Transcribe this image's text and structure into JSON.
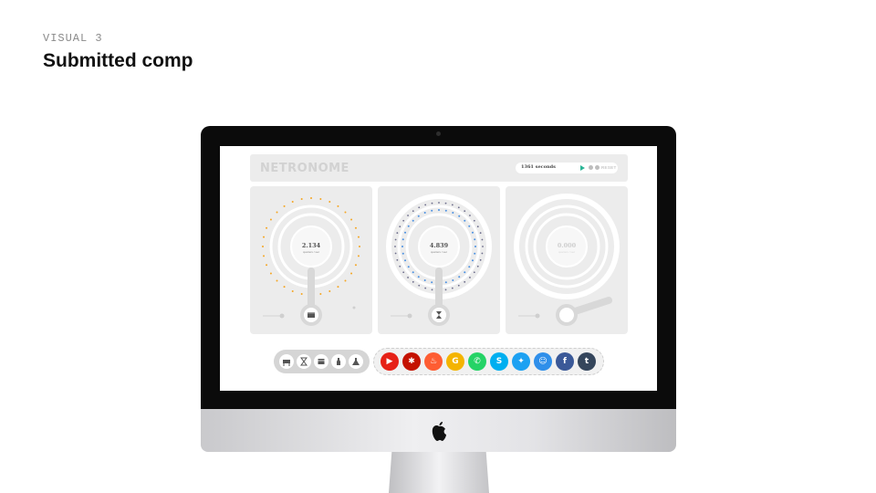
{
  "slide": {
    "label": "VISUAL 3",
    "title": "Submitted comp"
  },
  "app": {
    "logo": "NETRONOME",
    "timer": {
      "text": "1361 seconds",
      "reset_label": "RESET",
      "accent": "#2bb596"
    },
    "panels": [
      {
        "value": "2.134",
        "unit": "quarters / sec",
        "dot_color": "#f5a623",
        "active": true,
        "handle_icon": "box-icon"
      },
      {
        "value": "4.839",
        "unit": "quarters / sec",
        "dot_color": "#4a90e2",
        "active": true,
        "handle_icon": "hourglass-icon"
      },
      {
        "value": "0.000",
        "unit": "quarters / sec",
        "dot_color": "#e0e0e0",
        "active": false,
        "handle_icon": "none"
      }
    ],
    "sounds": [
      {
        "name": "piano-icon"
      },
      {
        "name": "hourglass-icon"
      },
      {
        "name": "box-icon"
      },
      {
        "name": "bottle-icon"
      },
      {
        "name": "flask-icon"
      }
    ],
    "share": [
      {
        "network": "youtube",
        "glyph": "▶",
        "color": "#e62117"
      },
      {
        "network": "yelp",
        "glyph": "✱",
        "color": "#c41200"
      },
      {
        "network": "tinder",
        "glyph": "♨",
        "color": "#fe5d32"
      },
      {
        "network": "google",
        "glyph": "G",
        "color": "#f4b400"
      },
      {
        "network": "whatsapp",
        "glyph": "✆",
        "color": "#25d366"
      },
      {
        "network": "skype",
        "glyph": "S",
        "color": "#00aff0"
      },
      {
        "network": "twitter",
        "glyph": "✦",
        "color": "#1da1f2"
      },
      {
        "network": "reddit",
        "glyph": "☺",
        "color": "#2f8fea"
      },
      {
        "network": "facebook",
        "glyph": "f",
        "color": "#3b5998"
      },
      {
        "network": "tumblr",
        "glyph": "t",
        "color": "#35465c"
      }
    ]
  }
}
